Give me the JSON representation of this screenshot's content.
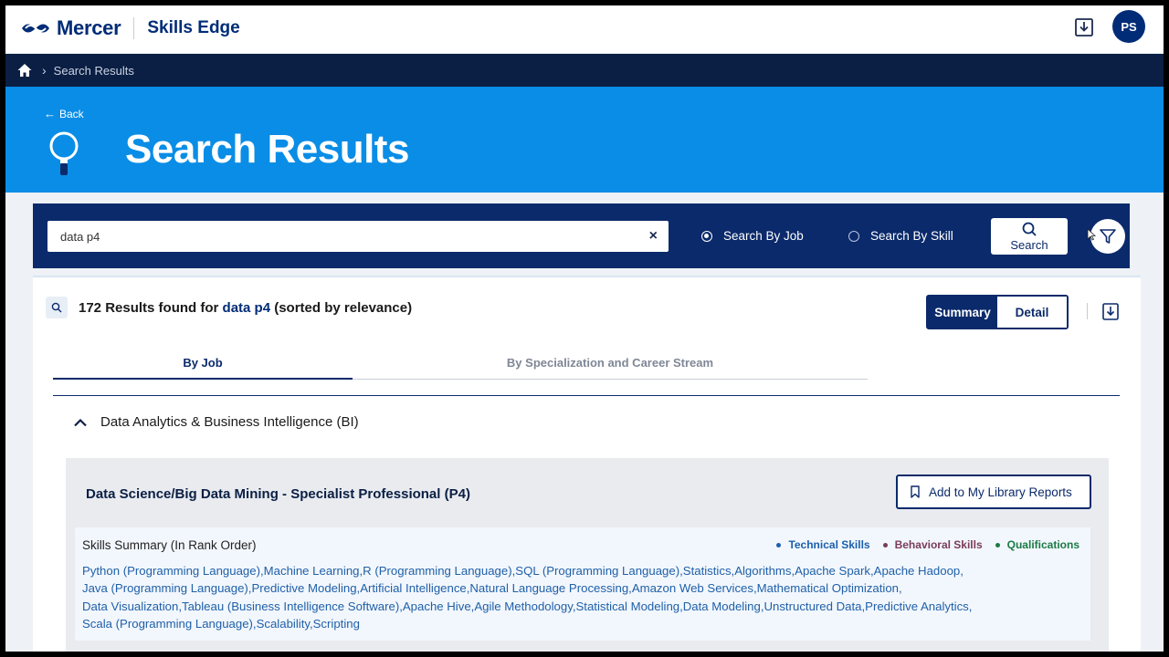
{
  "header": {
    "brand": "Mercer",
    "product": "Skills Edge",
    "user_initials": "PS"
  },
  "breadcrumb": {
    "current": "Search Results"
  },
  "hero": {
    "back_label": "Back",
    "title": "Search Results"
  },
  "search": {
    "query": "data p4",
    "clear_symbol": "×",
    "options": [
      {
        "label": "Search By Job",
        "selected": true
      },
      {
        "label": "Search By Skill",
        "selected": false
      }
    ],
    "button_label": "Search"
  },
  "results": {
    "count": "172",
    "text_mid": " Results found for ",
    "query": "data p4",
    "text_end": " (sorted by relevance)",
    "view_toggle": {
      "summary": "Summary",
      "detail": "Detail",
      "active": "Summary"
    },
    "tabs": [
      {
        "label": "By Job",
        "active": true
      },
      {
        "label": "By Specialization and Career Stream",
        "active": false
      }
    ],
    "group": {
      "title": "Data Analytics & Business Intelligence (BI)",
      "expanded": true
    },
    "job": {
      "title": "Data Science/Big Data Mining - Specialist Professional (P4)",
      "add_button": "Add to My Library Reports",
      "skills_heading": "Skills Summary (In Rank Order)",
      "legend": [
        {
          "label": "Technical Skills",
          "color": "#1b5fae"
        },
        {
          "label": "Behavioral Skills",
          "color": "#7a3b5a"
        },
        {
          "label": "Qualifications",
          "color": "#1b7a45"
        }
      ],
      "skills_lines": [
        "Python (Programming Language),Machine Learning,R (Programming Language),SQL (Programming Language),Statistics,Algorithms,Apache Spark,Apache Hadoop,",
        "Java (Programming Language),Predictive Modeling,Artificial Intelligence,Natural Language Processing,Amazon Web Services,Mathematical Optimization,",
        "Data Visualization,Tableau (Business Intelligence Software),Apache Hive,Agile Methodology,Statistical Modeling,Data Modeling,Unstructured Data,Predictive Analytics,",
        "Scala (Programming Language),Scalability,Scripting"
      ]
    }
  },
  "colors": {
    "navy": "#0b2a6b",
    "hero_blue": "#0a8de6",
    "breadcrumb_bg": "#0b1f44",
    "skill_text": "#2060a8"
  },
  "icons": [
    "mercer-logo-icon",
    "download-icon",
    "home-icon",
    "chevron-right-icon",
    "back-arrow-icon",
    "magnifier-illustration-icon",
    "clear-icon",
    "search-icon",
    "filter-icon",
    "bookmark-icon",
    "chevron-up-icon",
    "pointer-cursor-icon"
  ]
}
